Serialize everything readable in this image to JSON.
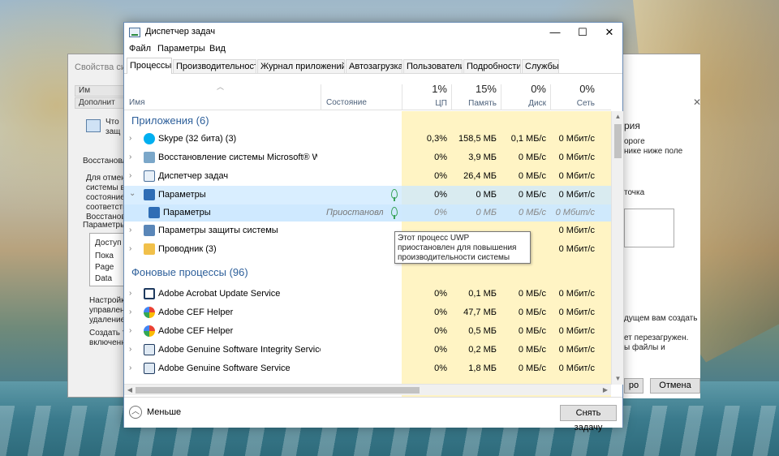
{
  "background_dialog": {
    "title": "Свойства сис",
    "tabs": [
      "Им",
      "Дополнит"
    ],
    "texts": [
      "Что",
      "защ",
      "Восстановлени",
      "Для отмен",
      "системы ве",
      "состояние",
      "соответств",
      "Восстановле",
      "Параметры",
      "Доступ",
      "Пока",
      "Page",
      "Data",
      "Настройк",
      "управлени",
      "удаление",
      "Создать т",
      "включенн"
    ],
    "right_texts": [
      "рия",
      "ороге",
      "нике ниже поле",
      "точка",
      "дущем вам создать",
      "ет перезагружен.",
      "ы файлы и"
    ],
    "buttons": {
      "ok_fragment": "ро",
      "cancel": "Отмена"
    }
  },
  "window": {
    "title": "Диспетчер задач",
    "controls": {
      "minimize": "—",
      "maximize": "☐",
      "close": "✕"
    }
  },
  "menu": [
    "Файл",
    "Параметры",
    "Вид"
  ],
  "tabs": [
    "Процессы",
    "Производительность",
    "Журнал приложений",
    "Автозагрузка",
    "Пользователи",
    "Подробности",
    "Службы"
  ],
  "columns": {
    "name": "Имя",
    "status": "Состояние",
    "metrics": [
      {
        "pct": "1%",
        "label": "ЦП"
      },
      {
        "pct": "15%",
        "label": "Память"
      },
      {
        "pct": "0%",
        "label": "Диск"
      },
      {
        "pct": "0%",
        "label": "Сеть"
      }
    ]
  },
  "rows": [
    {
      "kind": "group",
      "title": "Приложения (6)"
    },
    {
      "kind": "proc",
      "name": "Skype (32 бита) (3)",
      "icon": "skype-icon",
      "status": "",
      "cpu": "0,3%",
      "mem": "158,5 МБ",
      "disk": "0,1 МБ/с",
      "net": "0 Мбит/с"
    },
    {
      "kind": "proc",
      "name": "Восстановление системы Microsoft® Wi...",
      "icon": "system-restore-icon",
      "status": "",
      "cpu": "0%",
      "mem": "3,9 МБ",
      "disk": "0 МБ/с",
      "net": "0 Мбит/с"
    },
    {
      "kind": "proc",
      "name": "Диспетчер задач",
      "icon": "task-manager-icon",
      "status": "",
      "cpu": "0%",
      "mem": "26,4 МБ",
      "disk": "0 МБ/с",
      "net": "0 Мбит/с"
    },
    {
      "kind": "proc-expanded",
      "name": "Параметры",
      "icon": "settings-gear-icon",
      "status": "",
      "cpu": "0%",
      "mem": "0 МБ",
      "disk": "0 МБ/с",
      "net": "0 Мбит/с"
    },
    {
      "kind": "child",
      "name": "Параметры",
      "icon": "settings-gear-icon",
      "status": "Приостановл...",
      "cpu": "0%",
      "mem": "0 МБ",
      "disk": "0 МБ/с",
      "net": "0 Мбит/с"
    },
    {
      "kind": "proc",
      "name": "Параметры защиты системы",
      "icon": "system-protection-icon",
      "status": "",
      "cpu": "",
      "mem": "",
      "disk": "",
      "net": "0 Мбит/с"
    },
    {
      "kind": "proc",
      "name": "Проводник (3)",
      "icon": "folder-icon",
      "status": "",
      "cpu": "",
      "mem": "",
      "disk": "",
      "net": "0 Мбит/с"
    },
    {
      "kind": "group",
      "title": "Фоновые процессы (96)"
    },
    {
      "kind": "proc",
      "name": "Adobe Acrobat Update Service",
      "icon": "app-window-icon",
      "status": "",
      "cpu": "0%",
      "mem": "0,1 МБ",
      "disk": "0 МБ/с",
      "net": "0 Мбит/с"
    },
    {
      "kind": "proc",
      "name": "Adobe CEF Helper",
      "icon": "adobe-cef-icon",
      "status": "",
      "cpu": "0%",
      "mem": "47,7 МБ",
      "disk": "0 МБ/с",
      "net": "0 Мбит/с"
    },
    {
      "kind": "proc",
      "name": "Adobe CEF Helper",
      "icon": "adobe-cef-icon",
      "status": "",
      "cpu": "0%",
      "mem": "0,5 МБ",
      "disk": "0 МБ/с",
      "net": "0 Мбит/с"
    },
    {
      "kind": "proc",
      "name": "Adobe Genuine Software Integrity Service",
      "icon": "app-window-icon",
      "status": "",
      "cpu": "0%",
      "mem": "0,2 МБ",
      "disk": "0 МБ/с",
      "net": "0 Мбит/с"
    },
    {
      "kind": "proc",
      "name": "Adobe Genuine Software Service",
      "icon": "app-window-icon",
      "status": "",
      "cpu": "0%",
      "mem": "1,8 МБ",
      "disk": "0 МБ/с",
      "net": "0 Мбит/с"
    }
  ],
  "tooltip": "Этот процесс UWP приостановлен для повышения производительности системы",
  "footer": {
    "less": "Меньше",
    "end_task": "Снять задачу"
  },
  "colors": {
    "group_title": "#2d5f9a",
    "metric_bg": "#fff4c4",
    "selection": "#cce8ff",
    "leaf": "#3aa35a"
  }
}
